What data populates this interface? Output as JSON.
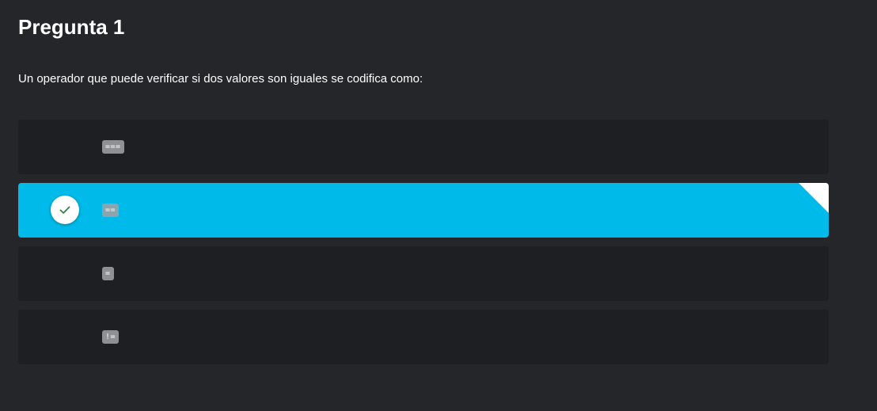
{
  "question": {
    "title": "Pregunta 1",
    "text": "Un operador que puede verificar si dos valores son iguales se codifica como:"
  },
  "options": [
    {
      "code": "===",
      "selected": false
    },
    {
      "code": "==",
      "selected": true
    },
    {
      "code": "=",
      "selected": false
    },
    {
      "code": "!=",
      "selected": false
    }
  ],
  "colors": {
    "background": "#252629",
    "option_background": "#1e1f22",
    "selected_background": "#00bbe9",
    "check_color": "#2e8540",
    "code_badge": "#8f9096"
  },
  "icons": {
    "selected_marker": "check-icon",
    "corner_marker": "corner-fold-icon"
  }
}
